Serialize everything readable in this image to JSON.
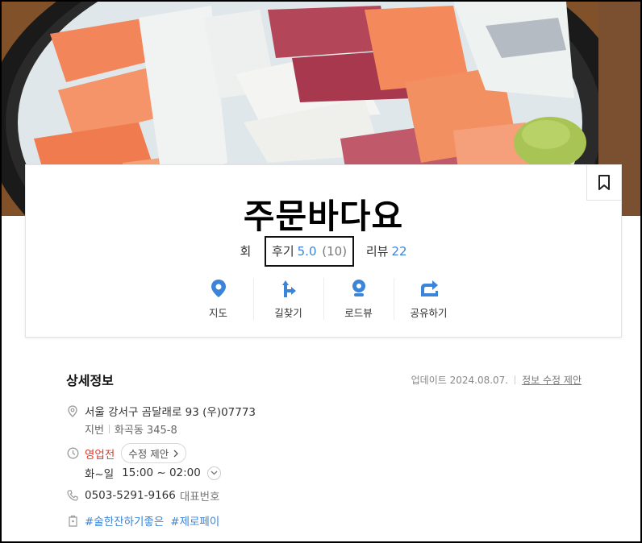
{
  "place": {
    "name": "주문바다요",
    "category": "회",
    "review_label": "후기",
    "rating": "5.0",
    "rating_count": "(10)",
    "blog_label": "리뷰",
    "blog_count": "22"
  },
  "actions": [
    {
      "label": "지도",
      "icon": "map-pin-icon"
    },
    {
      "label": "길찾기",
      "icon": "directions-icon"
    },
    {
      "label": "로드뷰",
      "icon": "roadview-icon"
    },
    {
      "label": "공유하기",
      "icon": "share-icon"
    }
  ],
  "details": {
    "section_title": "상세정보",
    "update_text": "업데이트 2024.08.07.",
    "suggest_link": "정보 수정 제안",
    "address": "서울 강서구 곰달래로 93 (우)07773",
    "jibun_label": "지번",
    "jibun": "화곡동 345-8",
    "status": "영업전",
    "edit_suggest": "수정 제안",
    "hours_days": "화~일",
    "hours_time": "15:00 ~ 02:00",
    "phone": "0503-5291-9166",
    "phone_label": "대표번호",
    "tags": [
      "#술한잔하기좋은",
      "#제로페이"
    ]
  },
  "colors": {
    "accent": "#3b84d9",
    "status_red": "#e0392b"
  }
}
